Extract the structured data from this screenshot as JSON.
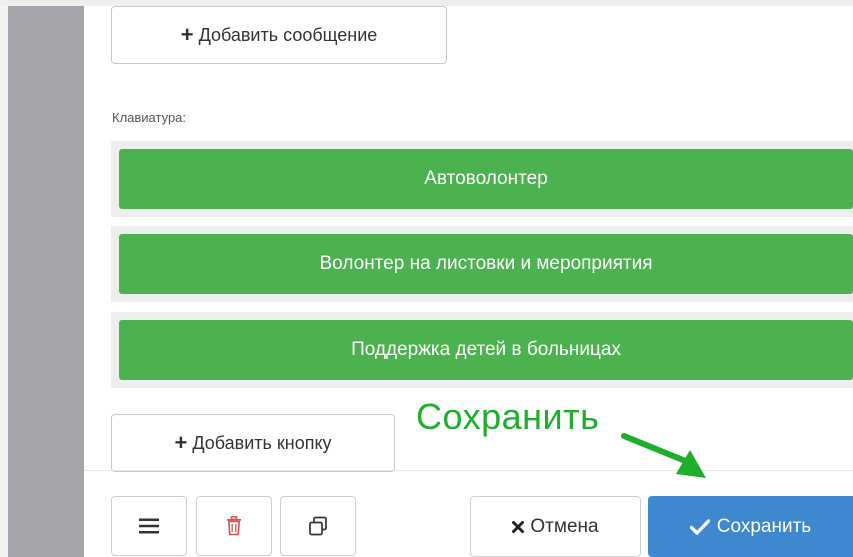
{
  "messages": {
    "add_message_label": "Добавить сообщение"
  },
  "keyboard": {
    "label": "Клавиатура:",
    "buttons": [
      {
        "label": "Автоволонтер"
      },
      {
        "label": "Волонтер на листовки и мероприятия"
      },
      {
        "label": "Поддержка детей в больницах"
      }
    ],
    "add_button_label": "Добавить кнопку",
    "button_color": "#4cb14f"
  },
  "footer": {
    "cancel_label": "Отмена",
    "save_label": "Сохранить",
    "icons": [
      "menu-icon",
      "trash-icon",
      "copy-icon",
      "close-icon",
      "check-icon"
    ],
    "save_color": "#3d88cf",
    "delete_icon_color": "#d9534f"
  },
  "annotation": {
    "text": "Сохранить",
    "color": "#1eae2a"
  }
}
